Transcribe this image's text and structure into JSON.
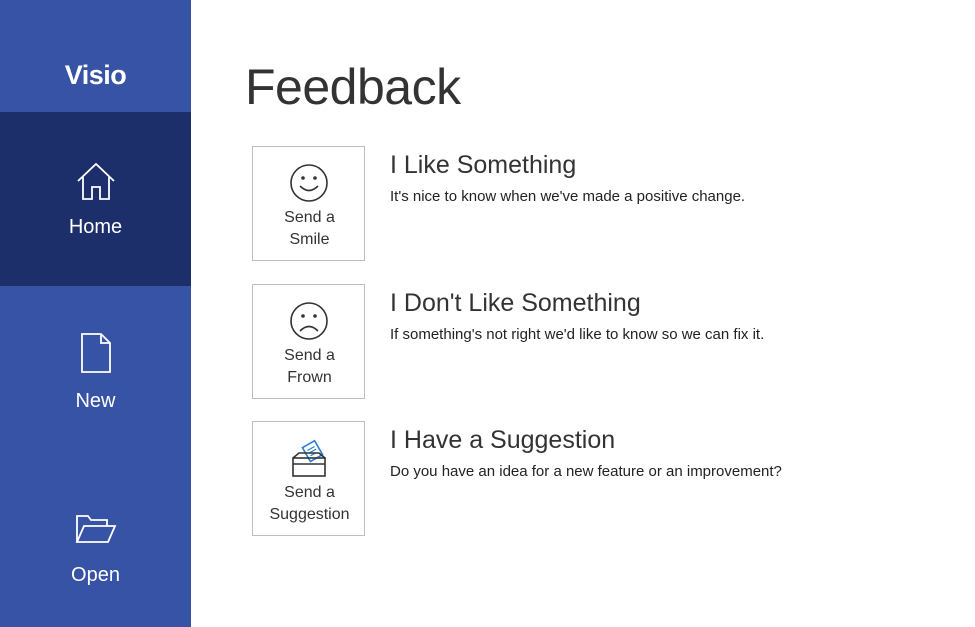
{
  "app": {
    "title": "Visio"
  },
  "sidebar": {
    "items": [
      {
        "label": "Home",
        "icon": "home-icon",
        "active": true
      },
      {
        "label": "New",
        "icon": "new-document-icon",
        "active": false
      },
      {
        "label": "Open",
        "icon": "folder-open-icon",
        "active": false
      }
    ]
  },
  "main": {
    "title": "Feedback",
    "options": [
      {
        "button_line1": "Send a",
        "button_line2": "Smile",
        "icon": "smile-icon",
        "heading": "I Like Something",
        "description": "It's nice to know when we've made a positive change."
      },
      {
        "button_line1": "Send a",
        "button_line2": "Frown",
        "icon": "frown-icon",
        "heading": "I Don't Like Something",
        "description": "If something's not right we'd like to know so we can fix it."
      },
      {
        "button_line1": "Send a",
        "button_line2": "Suggestion",
        "icon": "suggestion-box-icon",
        "heading": "I Have a Suggestion",
        "description": "Do you have an idea for a new feature or an improvement?"
      }
    ]
  },
  "colors": {
    "sidebar_bg": "#3753a6",
    "sidebar_active_bg": "#1c2f6b",
    "suggestion_accent": "#2b7cd3"
  }
}
